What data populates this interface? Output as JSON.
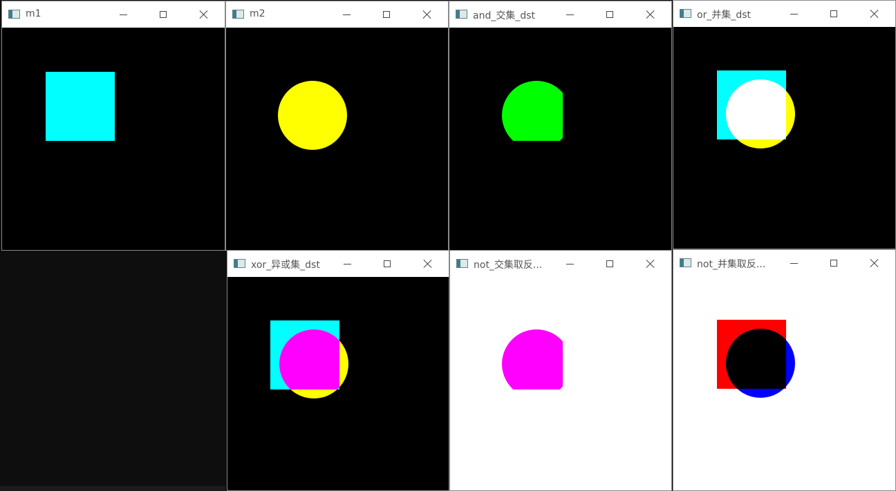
{
  "windows": [
    {
      "id": "m1",
      "title": "m1"
    },
    {
      "id": "m2",
      "title": "m2"
    },
    {
      "id": "and",
      "title": "and_交集_dst"
    },
    {
      "id": "or",
      "title": "or_并集_dst"
    },
    {
      "id": "xor",
      "title": "xor_异或集_dst"
    },
    {
      "id": "not_and",
      "title": "not_交集取反..."
    },
    {
      "id": "not_or",
      "title": "not_并集取反..."
    }
  ],
  "colors": {
    "cyan": "#00ffff",
    "yellow": "#ffff00",
    "green": "#00ff00",
    "white": "#ffffff",
    "magenta": "#ff00ff",
    "red": "#ff0000",
    "blue": "#0000ff",
    "black": "#000000"
  },
  "icons": {
    "app": "app-icon",
    "minimize": "minimize-icon",
    "maximize": "maximize-icon",
    "close": "close-icon"
  }
}
